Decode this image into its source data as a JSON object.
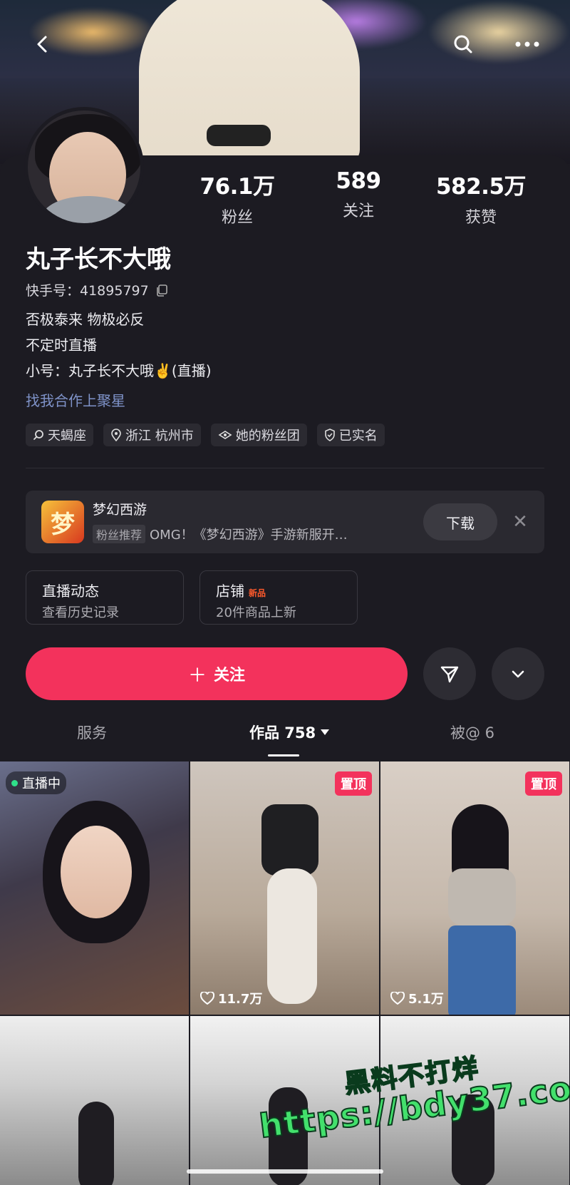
{
  "header": {
    "back_icon": "chevron-left-icon",
    "search_icon": "search-icon",
    "more_icon": "more-dots-icon"
  },
  "profile": {
    "stats": [
      {
        "value": "76.1万",
        "label": "粉丝"
      },
      {
        "value": "589",
        "label": "关注"
      },
      {
        "value": "582.5万",
        "label": "获赞"
      }
    ],
    "name": "丸子长不大哦",
    "kuaishou_id": "快手号：41895797",
    "bio": [
      "否极泰来 物极必反",
      "不定时直播",
      "小号：丸子长不大哦✌️(直播)"
    ],
    "collab_link": "找我合作上聚星",
    "tags": [
      {
        "icon": "search-icon",
        "label": "天蝎座"
      },
      {
        "icon": "location-pin-icon",
        "label": "浙江 杭州市"
      },
      {
        "icon": "fan-group-icon",
        "label": "她的粉丝团"
      },
      {
        "icon": "shield-check-icon",
        "label": "已实名"
      }
    ]
  },
  "ad": {
    "logo_text": "梦",
    "title": "梦幻西游",
    "chip": "粉丝推荐",
    "desc": "OMG！《梦幻西游》手游新服开…",
    "download_label": "下载",
    "close_label": "✕"
  },
  "quick": [
    {
      "title": "直播动态",
      "badge": "",
      "sub": "查看历史记录"
    },
    {
      "title": "店铺",
      "badge": "新品",
      "sub": "20件商品上新"
    }
  ],
  "actions": {
    "follow_label": "关注",
    "follow_plus": "＋"
  },
  "tabs": {
    "service": "服务",
    "works": "作品 758",
    "mentioned": "被@ 6"
  },
  "grid": [
    {
      "badge": "直播中",
      "likes": ""
    },
    {
      "badge": "置顶",
      "likes": "11.7万"
    },
    {
      "badge": "置顶",
      "likes": "5.1万"
    },
    {
      "badge": "",
      "likes": ""
    },
    {
      "badge": "",
      "likes": ""
    },
    {
      "badge": "",
      "likes": ""
    }
  ],
  "watermark": {
    "line1": "黑料不打烊",
    "line2": "https://bdy37.co"
  },
  "colors": {
    "accent": "#f3325c",
    "link": "#7f93c9",
    "bg": "#1c1b22"
  }
}
